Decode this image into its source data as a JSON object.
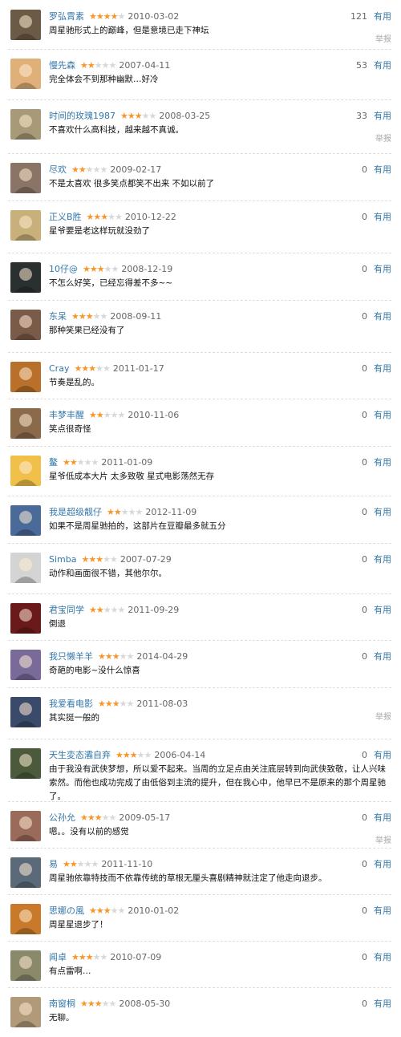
{
  "ui": {
    "useful_label": "有用",
    "report_label": "举报"
  },
  "reviews": [
    {
      "user": "罗弘霄素",
      "rating": 4,
      "date": "2010-03-02",
      "votes": "121",
      "text": "周星驰形式上的巅峰，但是意境已走下神坛",
      "report": true,
      "avatar": "#6b5a45"
    },
    {
      "user": "慢先森",
      "rating": 2,
      "date": "2007-04-11",
      "votes": "53",
      "text": "完全体会不到那种幽默…好冷",
      "report": false,
      "avatar": "#e0b07a"
    },
    {
      "user": "时间的玫瑰1987",
      "rating": 3,
      "date": "2008-03-25",
      "votes": "33",
      "text": "不喜欢什么高科技，越来越不真诚。",
      "report": true,
      "avatar": "#a89a78"
    },
    {
      "user": "尽欢",
      "rating": 2,
      "date": "2009-02-17",
      "votes": "0",
      "text": "不是太喜欢 很多笑点都笑不出来 不如以前了",
      "report": false,
      "avatar": "#8a7466"
    },
    {
      "user": "正义B胜",
      "rating": 3,
      "date": "2010-12-22",
      "votes": "0",
      "text": "星爷要是老这样玩就没劲了",
      "report": false,
      "avatar": "#c8b07a"
    },
    {
      "user": "10仔@",
      "rating": 3,
      "date": "2008-12-19",
      "votes": "0",
      "text": "不怎么好笑，已经忘得差不多~~",
      "report": false,
      "avatar": "#2a3030"
    },
    {
      "user": "东呆",
      "rating": 3,
      "date": "2008-09-11",
      "votes": "0",
      "text": "那种笑果已经没有了",
      "report": false,
      "avatar": "#7a5a48"
    },
    {
      "user": "Cray",
      "rating": 3,
      "date": "2011-01-17",
      "votes": "0",
      "text": "节奏是乱的。",
      "report": false,
      "avatar": "#b8702a"
    },
    {
      "user": "丰梦丰醒",
      "rating": 2,
      "date": "2010-11-06",
      "votes": "0",
      "text": "笑点很奇怪",
      "report": false,
      "avatar": "#8a6a4a"
    },
    {
      "user": "鳌",
      "rating": 2,
      "date": "2011-01-09",
      "votes": "0",
      "text": "星爷低成本大片 太多致敬 星式电影荡然无存",
      "report": false,
      "avatar": "#f0c04a"
    },
    {
      "user": "我是超级靓仔",
      "rating": 2,
      "date": "2012-11-09",
      "votes": "0",
      "text": "如果不是周星驰拍的，这部片在豆瓣最多就五分",
      "report": false,
      "avatar": "#4a6a9a"
    },
    {
      "user": "Simba",
      "rating": 3,
      "date": "2007-07-29",
      "votes": "0",
      "text": "动作和画面很不错，其他尔尔。",
      "report": false,
      "avatar": "#d4d4d4"
    },
    {
      "user": "君宝同学",
      "rating": 2,
      "date": "2011-09-29",
      "votes": "0",
      "text": "倒退",
      "report": false,
      "avatar": "#6a1a1a"
    },
    {
      "user": "我只懒羊羊",
      "rating": 3,
      "date": "2014-04-29",
      "votes": "0",
      "text": "奇葩的电影~没什么惊喜",
      "report": false,
      "avatar": "#7a6a9a"
    },
    {
      "user": "我爱看电影",
      "rating": 3,
      "date": "2011-08-03",
      "votes": "",
      "text": "其实挺一般的",
      "report": true,
      "avatar": "#3a4a6a"
    },
    {
      "user": "天生変态灞自弃",
      "rating": 3,
      "date": "2006-04-14",
      "votes": "0",
      "text": "由于我没有武侠梦想，所以爱不起来。当周的立足点由关注底层转到向武侠致敬，让人兴味索然。而他也成功完成了由低俗到主流的提升，但在我心中，他早已不是原来的那个周星驰了。",
      "report": false,
      "avatar": "#4a5a3a"
    },
    {
      "user": "公孙允",
      "rating": 3,
      "date": "2009-05-17",
      "votes": "0",
      "text": "嗯。。没有以前的感觉",
      "report": true,
      "avatar": "#9a6a5a"
    },
    {
      "user": "易",
      "rating": 2,
      "date": "2011-11-10",
      "votes": "0",
      "text": "周星驰依靠特技而不依靠传统的草根无厘头喜剧精神就注定了他走向退步。",
      "report": false,
      "avatar": "#5a6a7a"
    },
    {
      "user": "思娜の風",
      "rating": 3,
      "date": "2010-01-02",
      "votes": "0",
      "text": "周星星退步了！",
      "report": false,
      "avatar": "#c87a2a"
    },
    {
      "user": "闻卓",
      "rating": 3,
      "date": "2010-07-09",
      "votes": "0",
      "text": "有点雷啊…",
      "report": false,
      "avatar": "#8a8a6a"
    },
    {
      "user": "南窗桐",
      "rating": 3,
      "date": "2008-05-30",
      "votes": "0",
      "text": "无聊。",
      "report": false,
      "avatar": "#b09a7a"
    }
  ]
}
